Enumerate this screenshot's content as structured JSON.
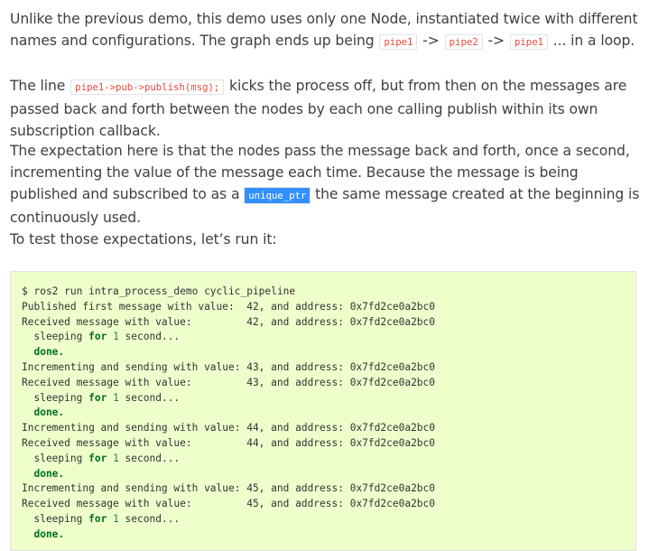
{
  "paragraphs": {
    "p1": {
      "t1": "Unlike the previous demo, this demo uses only one Node, instantiated twice with different names and configurations. The graph ends up being ",
      "c1": "pipe1",
      "a1": " -> ",
      "c2": "pipe2",
      "a2": " -> ",
      "c3": "pipe1",
      "t2": " ... in a loop."
    },
    "p2": {
      "t1": "The line ",
      "c1": "pipe1->pub->publish(msg);",
      "t2": " kicks the process off, but from then on the messages are passed back and forth between the nodes by each one calling publish within its own subscription callback."
    },
    "p3": {
      "t1": "The expectation here is that the nodes pass the message back and forth, once a second, incrementing the value of the message each time. Because the message is being published and subscribed to as a ",
      "c1": "unique_ptr",
      "t2": " the same message created at the beginning is continuously used."
    },
    "p4": {
      "t1": "To test those expectations, let’s run it:"
    }
  },
  "console": {
    "cmd": "$ ros2 run intra_process_demo cyclic_pipeline",
    "published": "Published first message with value:  42, and address: 0x7fd2ce0a2bc0",
    "recv42": "Received message with value:         42, and address: 0x7fd2ce0a2bc0",
    "sleep_pre": "  sleeping ",
    "sleep_for": "for",
    "sleep_space": " ",
    "sleep_num": "1",
    "sleep_post": " second...",
    "done": "  done.",
    "inc43": "Incrementing and sending with value: 43, and address: 0x7fd2ce0a2bc0",
    "recv43": "Received message with value:         43, and address: 0x7fd2ce0a2bc0",
    "inc44": "Incrementing and sending with value: 44, and address: 0x7fd2ce0a2bc0",
    "recv44": "Received message with value:         44, and address: 0x7fd2ce0a2bc0",
    "inc45": "Incrementing and sending with value: 45, and address: 0x7fd2ce0a2bc0",
    "recv45": "Received message with value:         45, and address: 0x7fd2ce0a2bc0"
  },
  "colors": {
    "code_literal": "#e74c3c",
    "selection": "#3390ff",
    "console_bg": "#eeffcc",
    "keyword": "#007020",
    "number": "#208050"
  }
}
